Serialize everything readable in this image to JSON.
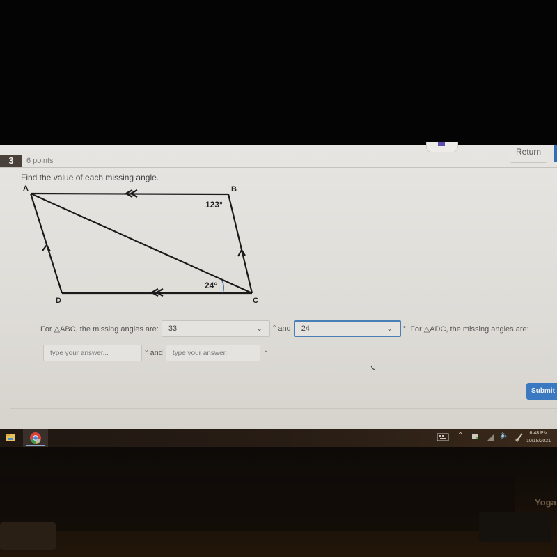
{
  "header": {
    "question_number": "3",
    "points": "6 points",
    "return_label": "Return"
  },
  "question": {
    "prompt": "Find the value of each missing angle.",
    "diagram": {
      "vertices": [
        "A",
        "B",
        "C",
        "D"
      ],
      "given_angles": {
        "angle_B": "123°",
        "angle_ACD": "24°"
      }
    }
  },
  "answers": {
    "abc_prefix": "For △ABC, the missing angles are:",
    "abc_first_value": "33",
    "deg_and_1": "° and",
    "abc_second_value": "24",
    "adc_prefix": "°. For △ADC, the missing angles are:",
    "adc_first_placeholder": "type your answer...",
    "deg_and_2": "° and",
    "adc_second_placeholder": "type your answer...",
    "deg_end": "°",
    "chevron_icon": "chevron-down"
  },
  "actions": {
    "submit_label": "Submit"
  },
  "taskbar": {
    "time": "6:48 PM",
    "date": "10/18/2021",
    "tray_icons": [
      "keyboard",
      "chevron-up",
      "battery",
      "wifi",
      "volume",
      "pen"
    ],
    "pinned_apps": [
      "file-explorer",
      "chrome"
    ]
  },
  "device": {
    "brand": "Yoga"
  }
}
